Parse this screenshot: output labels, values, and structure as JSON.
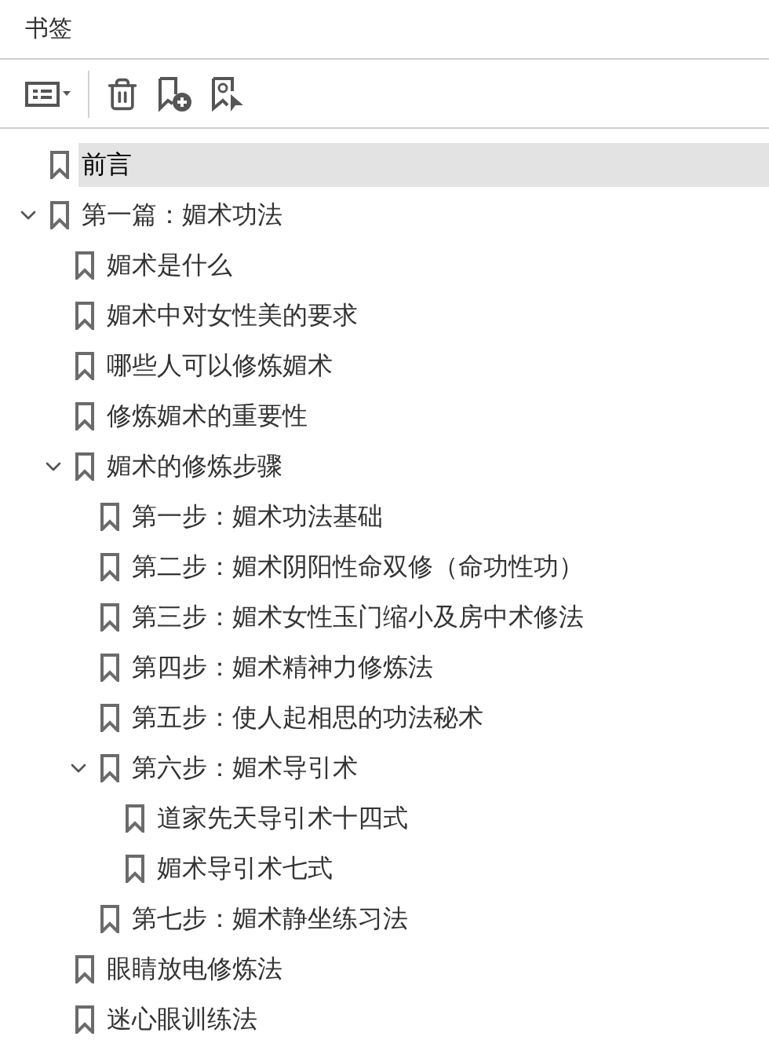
{
  "panel": {
    "title": "书签"
  },
  "bookmarks": [
    {
      "label": "前言",
      "selected": true
    },
    {
      "label": "第一篇：媚术功法",
      "selected": false,
      "expanded": true,
      "children": [
        {
          "label": "媚术是什么",
          "selected": false
        },
        {
          "label": "媚术中对女性美的要求",
          "selected": false
        },
        {
          "label": "哪些人可以修炼媚术",
          "selected": false
        },
        {
          "label": "修炼媚术的重要性",
          "selected": false
        },
        {
          "label": "媚术的修炼步骤",
          "selected": false,
          "expanded": true,
          "children": [
            {
              "label": "第一步：媚术功法基础",
              "selected": false
            },
            {
              "label": "第二步：媚术阴阳性命双修（命功性功）",
              "selected": false
            },
            {
              "label": "第三步：媚术女性玉门缩小及房中术修法",
              "selected": false
            },
            {
              "label": "第四步：媚术精神力修炼法",
              "selected": false
            },
            {
              "label": "第五步：使人起相思的功法秘术",
              "selected": false
            },
            {
              "label": "第六步：媚术导引术",
              "selected": false,
              "expanded": true,
              "children": [
                {
                  "label": "道家先天导引术十四式",
                  "selected": false
                },
                {
                  "label": "媚术导引术七式",
                  "selected": false
                }
              ]
            },
            {
              "label": "第七步：媚术静坐练习法",
              "selected": false
            }
          ]
        },
        {
          "label": "眼睛放电修炼法",
          "selected": false
        },
        {
          "label": "迷心眼训练法",
          "selected": false
        }
      ]
    }
  ]
}
